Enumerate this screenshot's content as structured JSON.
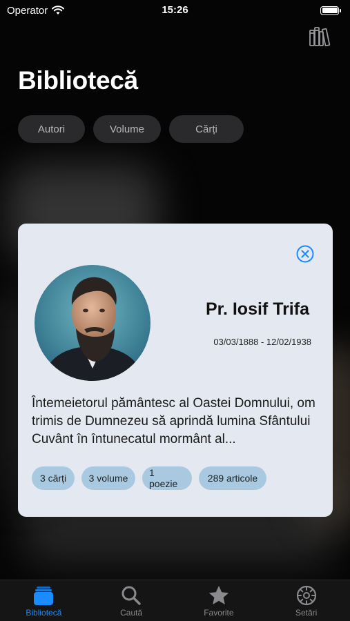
{
  "status_bar": {
    "carrier": "Operator",
    "time": "15:26"
  },
  "header": {
    "title": "Bibliotecă",
    "icon": "books-icon"
  },
  "segments": [
    "Autori",
    "Volume",
    "Cărți"
  ],
  "card": {
    "name": "Pr. Iosif Trifa",
    "dates": "03/03/1888 - 12/02/1938",
    "bio": "Întemeietorul pământesc al Oastei Domnului, om trimis de Dumnezeu să aprindă lumina Sfântului Cuvânt în întunecatul mormânt al...",
    "tags": [
      "3 cărți",
      "3 volume",
      "1 poezie",
      "289 articole"
    ],
    "accent_color": "#1a8cff"
  },
  "tab_bar": {
    "items": [
      {
        "label": "Bibliotecă",
        "icon": "library-icon",
        "active": true
      },
      {
        "label": "Caută",
        "icon": "search-icon",
        "active": false
      },
      {
        "label": "Favorite",
        "icon": "star-icon",
        "active": false
      },
      {
        "label": "Setări",
        "icon": "gear-icon",
        "active": false
      }
    ],
    "active_color": "#1a8cff",
    "inactive_color": "#8a8a8e"
  }
}
